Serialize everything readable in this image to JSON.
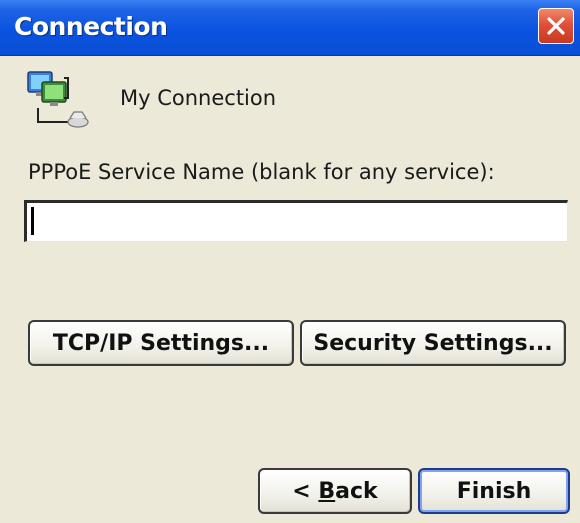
{
  "window": {
    "title": "Connection",
    "close_icon": "close-icon"
  },
  "connection": {
    "icon": "network-connection-icon",
    "name": "My Connection"
  },
  "form": {
    "service_label": "PPPoE Service Name (blank for any service):",
    "service_value": "",
    "service_placeholder": ""
  },
  "buttons": {
    "tcpip": "TCP/IP Settings...",
    "security": "Security Settings...",
    "back_prefix": "< ",
    "back_mnemonic": "B",
    "back_rest": "ack",
    "finish": "Finish"
  },
  "colors": {
    "titlebar": "#0a53e0",
    "close_button": "#e0503a",
    "dialog_bg": "#ece9d8"
  }
}
